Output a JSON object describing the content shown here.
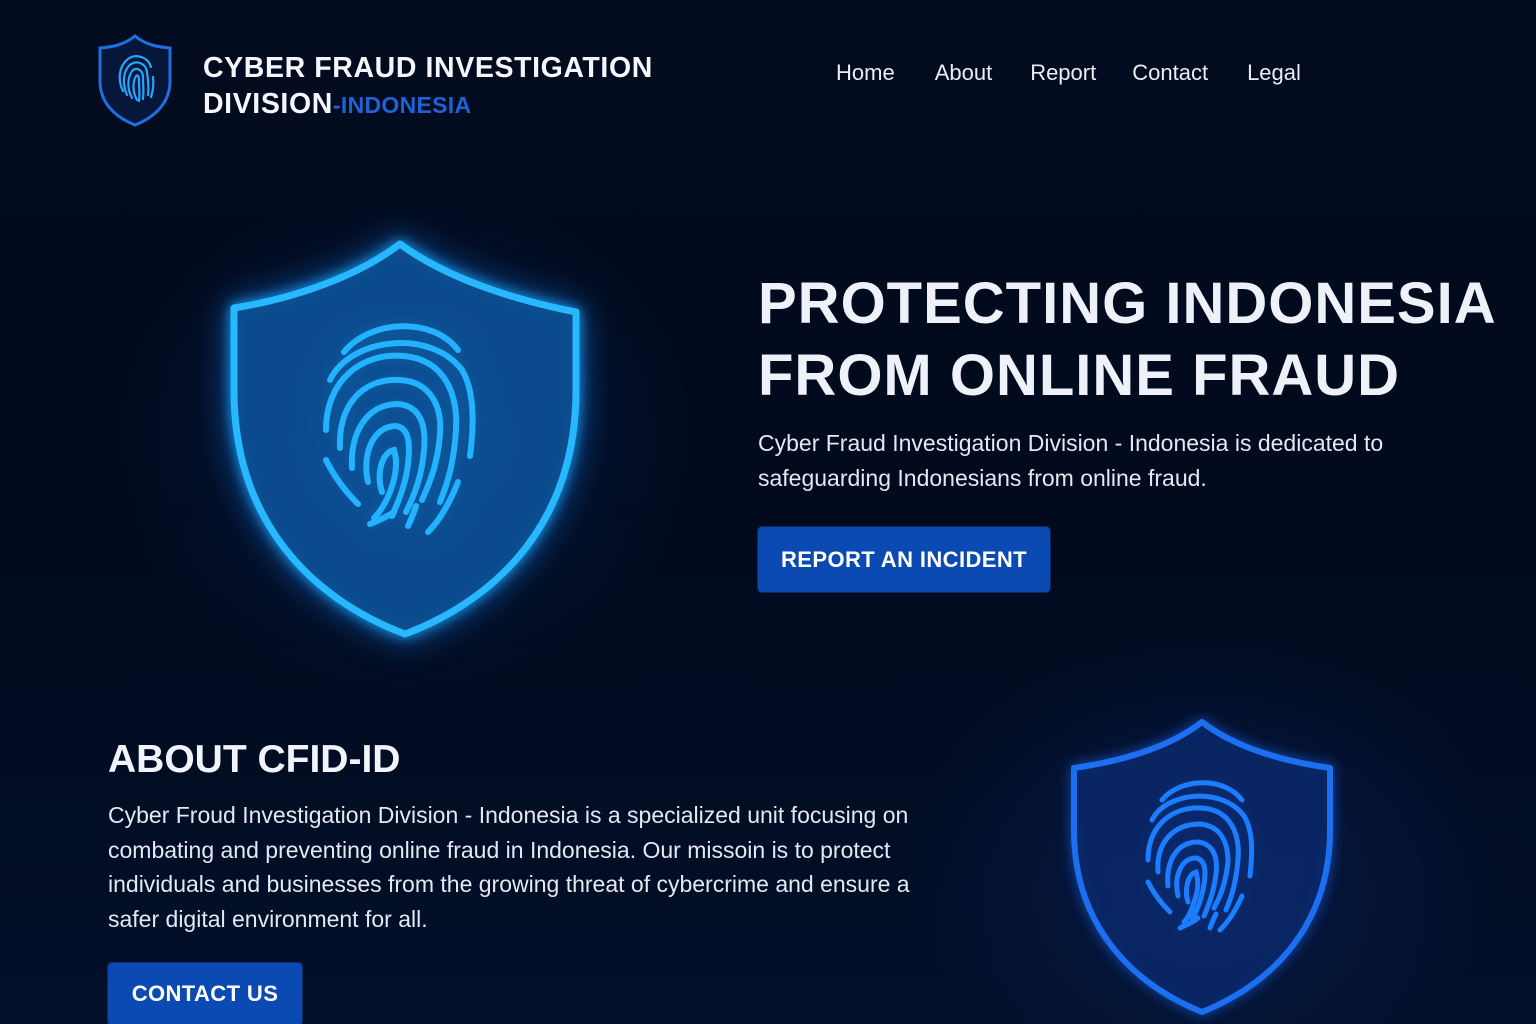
{
  "header": {
    "brand_line1": "CYBER FRAUD INVESTIGATION",
    "brand_line2": "DIVISION",
    "brand_dash": "-",
    "brand_country": "INDONESIA",
    "logo_icon": "shield-fingerprint-icon",
    "nav": [
      {
        "label": "Home"
      },
      {
        "label": "About"
      },
      {
        "label": "Report"
      },
      {
        "label": "Contact"
      },
      {
        "label": "Legal"
      }
    ]
  },
  "hero": {
    "title_line1": "PROTECTING INDONESIA",
    "title_line2": "FROM ONLINE FRAUD",
    "description": "Cyber Fraud Investigation Division - Indonesia is dedicated to safeguarding Indonesians from online fraud.",
    "cta_label": "REPORT AN INCIDENT",
    "image_icon": "shield-fingerprint-icon"
  },
  "about": {
    "title": "ABOUT CFID-ID",
    "description": "Cyber Froud Investigation Division - Indonesia is a specialized unit focusing on combating and preventing online fraud in Indonesia. Our missoin is to protect individuals and businesses from the growing threat of cybercrime and ensure a safer digital environment for all.",
    "cta_label": "CONTACT US",
    "image_icon": "shield-fingerprint-icon"
  },
  "colors": {
    "background": "#020a1c",
    "accent": "#1e63d6",
    "button": "#0b49b3",
    "glow": "#18a8ff",
    "text": "#ffffff"
  }
}
